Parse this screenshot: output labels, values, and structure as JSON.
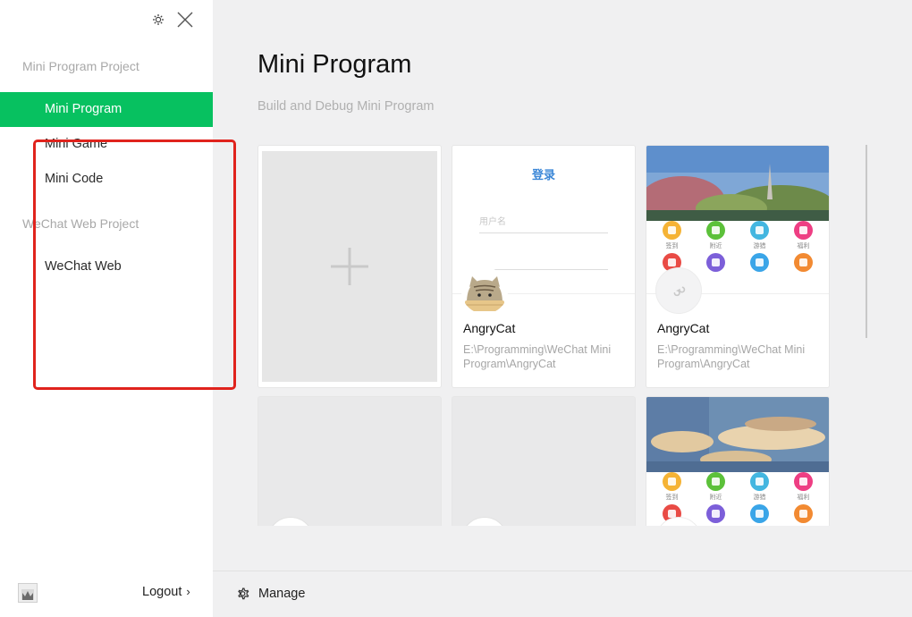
{
  "sidebar": {
    "sections": [
      {
        "title": "Mini Program Project"
      },
      {
        "title": "WeChat Web Project"
      }
    ],
    "items": [
      {
        "label": "Mini Program",
        "active": true
      },
      {
        "label": "Mini Game"
      },
      {
        "label": "Mini Code"
      },
      {
        "label": "WeChat Web"
      }
    ],
    "logout_label": "Logout",
    "logout_chevron": "›"
  },
  "main": {
    "title": "Mini Program",
    "subtitle": "Build and Debug Mini Program",
    "projects": [
      {
        "name": "AngryCat",
        "path": "E:\\Programming\\WeChat Mini Program\\AngryCat",
        "preview": "login"
      },
      {
        "name": "AngryCat",
        "path": "E:\\Programming\\WeChat Mini Program\\AngryCat",
        "preview": "park"
      }
    ],
    "login_preview": {
      "title": "登录",
      "username_placeholder": "用户名"
    },
    "preview_icons": [
      {
        "label": "签到",
        "color": "#f5b335"
      },
      {
        "label": "附近",
        "color": "#5cc13a"
      },
      {
        "label": "游猎",
        "color": "#43b6e0"
      },
      {
        "label": "福利",
        "color": "#ee3e83"
      }
    ],
    "preview_icons_row2": [
      {
        "color": "#e94b45"
      },
      {
        "color": "#7c5fd9"
      },
      {
        "color": "#3aa5e8"
      },
      {
        "color": "#f28a32"
      }
    ]
  },
  "bottom": {
    "manage_label": "Manage"
  },
  "colors": {
    "accent": "#07c160",
    "highlight": "#e0231d"
  }
}
